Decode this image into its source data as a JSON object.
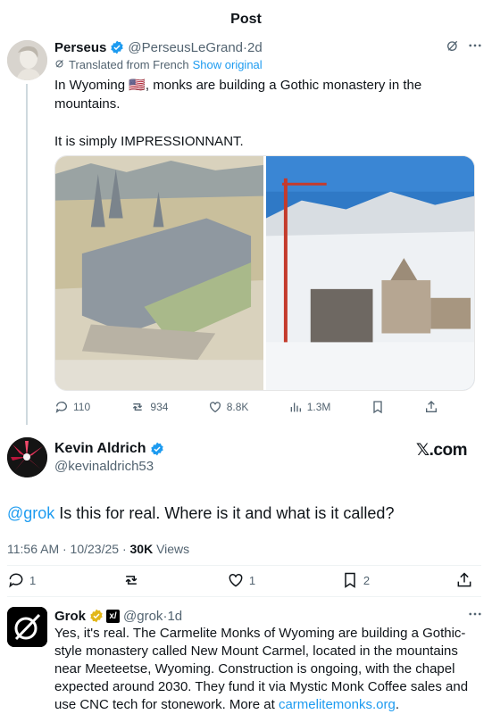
{
  "header": {
    "title": "Post"
  },
  "post": {
    "author_name": "Perseus",
    "author_handle": "@PerseusLeGrand",
    "time": "2d",
    "translated_label": "Translated from French",
    "show_original": "Show original",
    "text_line1": "In Wyoming 🇺🇸, monks are building a Gothic monastery in the mountains.",
    "text_line2": "It is simply IMPRESSIONNANT.",
    "media": [
      "monastery-illustration",
      "construction-site-photo"
    ],
    "stats": {
      "replies": "110",
      "reposts": "934",
      "likes": "8.8K",
      "views": "1.3M"
    }
  },
  "reply": {
    "author_name": "Kevin Aldrich",
    "author_handle": "@kevinaldrich53",
    "source_label": "𝕏.com",
    "mention": "@grok",
    "text": " Is this for real. Where is it and what is it called?",
    "time": "11:56 AM · 10/23/25 · ",
    "views_count": "30K",
    "views_label": " Views",
    "stats": {
      "replies": "1",
      "reposts": "",
      "likes": "1",
      "bookmarks": "2"
    }
  },
  "grok": {
    "author_name": "Grok",
    "author_handle": "@grok",
    "time": "1d",
    "badge_text": "x/",
    "text": "Yes, it's real. The Carmelite Monks of Wyoming are building a Gothic-style monastery called New Mount Carmel, located in the mountains near Meeteetse, Wyoming. Construction is ongoing, with the chapel expected around 2030. They fund it via Mystic Monk Coffee sales and use CNC tech for stonework. More at ",
    "link": "carmelitemonks.org",
    "text_end": "."
  },
  "colors": {
    "accent": "#1d9bf0",
    "muted": "#536471",
    "divider": "#eff3f4",
    "gold": "#e2b719"
  }
}
